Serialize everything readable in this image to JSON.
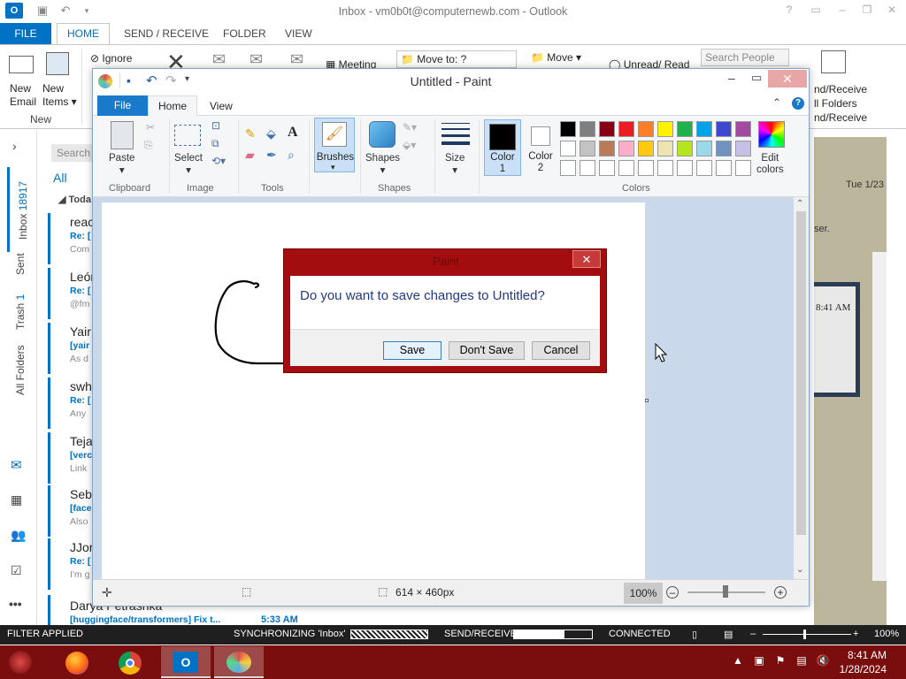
{
  "outlook": {
    "title": "Inbox - vm0b0t@computernewb.com - Outlook",
    "tabs": [
      "FILE",
      "HOME",
      "SEND / RECEIVE",
      "FOLDER",
      "VIEW"
    ],
    "ribbon": {
      "new_email": "New Email",
      "new_email_l1": "New",
      "new_email_l2": "Email",
      "new_items_l1": "New",
      "new_items_l2": "Items",
      "group_new": "New",
      "ignore": "Ignore",
      "meeting": "Meeting",
      "move_to": "Move to: ?",
      "move": "Move",
      "unread_read": "Unread/ Read",
      "search_people": "Search People",
      "send_receive_l1": "nd/Receive",
      "send_receive_l2": "ll Folders",
      "send_receive_l3": "nd/Receive"
    },
    "search_placeholder": "Search",
    "filter_all": "All",
    "group_today": "Toda",
    "folders": {
      "inbox": "Inbox",
      "inbox_count": "18917",
      "sent": "Sent",
      "trash": "Trash",
      "trash_count": "1",
      "all_folders": "All Folders"
    },
    "messages": [
      {
        "name": "reac",
        "subject": "Re: [",
        "preview": "Com"
      },
      {
        "name": "León",
        "subject": "Re: [",
        "preview": "@fm"
      },
      {
        "name": "Yair",
        "subject": "[yair",
        "preview": "As d"
      },
      {
        "name": "swh",
        "subject": "Re: [",
        "preview": "Any"
      },
      {
        "name": "Teja",
        "subject": "[verc",
        "preview": "Link"
      },
      {
        "name": "Seb",
        "subject": "[face",
        "preview": "Also"
      },
      {
        "name": "JJor",
        "subject": "Re: [",
        "preview": "I'm g"
      },
      {
        "name": "Darya Petrashka",
        "subject": "[huggingface/transformers] Fix t...",
        "time": "5:33 AM"
      }
    ],
    "reading": {
      "date": "Tue 1/23",
      "fragment": "ser.",
      "time": "8:41 AM"
    },
    "status": {
      "filter": "FILTER APPLIED",
      "sync": "SYNCHRONIZING  'Inbox'",
      "send_receive": "SEND/RECEIVE",
      "connected": "CONNECTED",
      "zoom": "100%"
    }
  },
  "paint": {
    "title": "Untitled - Paint",
    "tabs": {
      "file": "File",
      "home": "Home",
      "view": "View"
    },
    "ribbon": {
      "paste": "Paste",
      "clipboard": "Clipboard",
      "select": "Select",
      "image": "Image",
      "tools": "Tools",
      "brushes": "Brushes",
      "shapes": "Shapes",
      "shapes_group": "Shapes",
      "size": "Size",
      "color1_l1": "Color",
      "color1_l2": "1",
      "color2_l1": "Color",
      "color2_l2": "2",
      "edit_colors_l1": "Edit",
      "edit_colors_l2": "colors",
      "colors_group": "Colors"
    },
    "palette": [
      "#000000",
      "#7f7f7f",
      "#880015",
      "#ed1c24",
      "#ff7f27",
      "#fff200",
      "#22b14c",
      "#00a2e8",
      "#3f48cc",
      "#a349a4",
      "#ffffff",
      "#c3c3c3",
      "#b97a57",
      "#ffaec9",
      "#ffc90e",
      "#efe4b0",
      "#b5e61d",
      "#99d9ea",
      "#7092be",
      "#c8bfe7",
      "#ffffff",
      "#ffffff",
      "#ffffff",
      "#ffffff",
      "#ffffff",
      "#ffffff",
      "#ffffff",
      "#ffffff",
      "#ffffff",
      "#ffffff"
    ],
    "status": {
      "dimensions": "614 × 460px",
      "zoom": "100%"
    }
  },
  "dialog": {
    "title": "Paint",
    "message": "Do you want to save changes to Untitled?",
    "save": "Save",
    "dont_save": "Don't Save",
    "cancel": "Cancel"
  },
  "taskbar": {
    "time": "8:41 AM",
    "date": "1/28/2024"
  }
}
